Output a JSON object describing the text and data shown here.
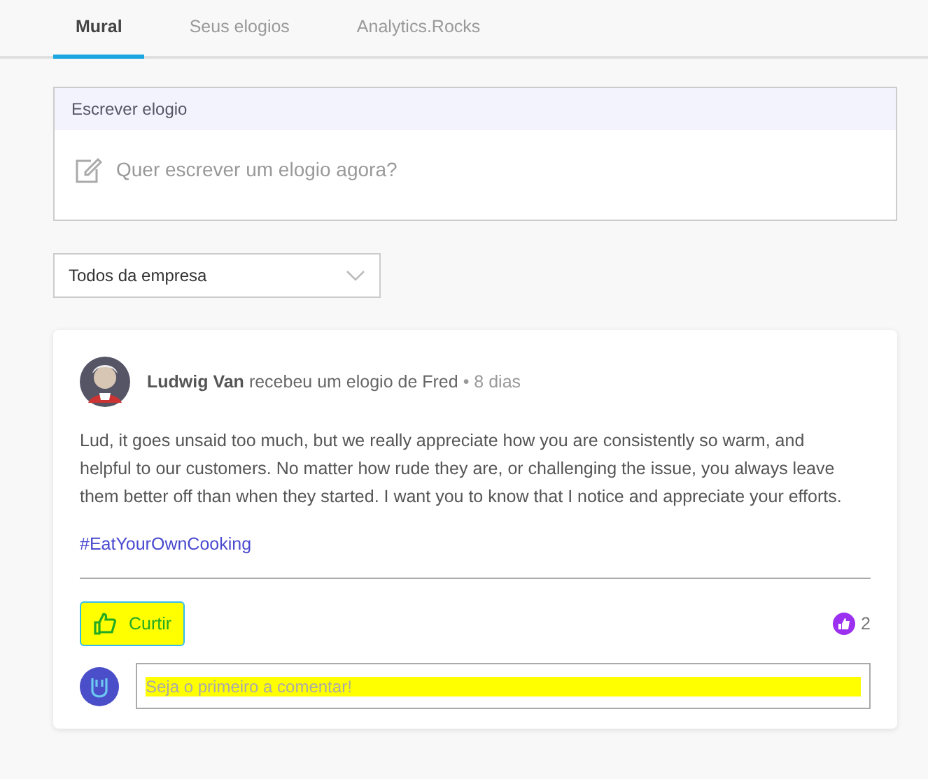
{
  "tabs": [
    {
      "label": "Mural",
      "selected": true
    },
    {
      "label": "Seus elogios",
      "selected": false
    },
    {
      "label": "Analytics.Rocks",
      "selected": false
    }
  ],
  "compose": {
    "title": "Escrever elogio",
    "prompt": "Quer escrever um elogio agora?"
  },
  "filter": {
    "value": "Todos da empresa"
  },
  "post": {
    "author": "Ludwig Van",
    "action": "recebeu um elogio de Fred",
    "time": "• 8 dias",
    "body": "Lud, it goes unsaid too much, but we really appreciate how you are consistently so warm, and helpful to our customers. No matter how rude they are, or challenging the issue, you always leave them better off than when they started. I want you to know that I notice and appreciate your efforts.",
    "hashtag": "#EatYourOwnCooking",
    "like_label": "Curtir",
    "like_count": "2",
    "comment_placeholder": "Seja o primeiro a comentar!"
  }
}
